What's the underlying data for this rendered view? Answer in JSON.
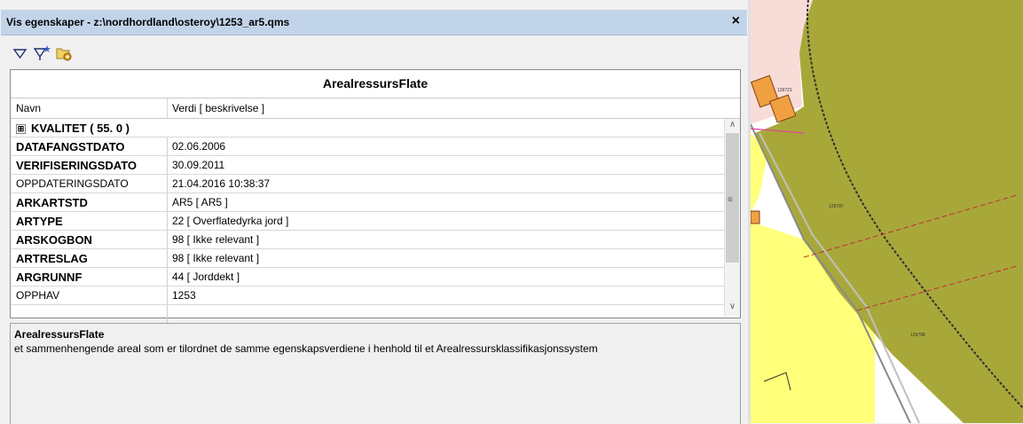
{
  "window": {
    "title": "Vis egenskaper - z:\\nordhordland\\osteroy\\1253_ar5.qms",
    "close_glyph": "×"
  },
  "toolbar": {
    "icons": [
      "filter-icon",
      "filter-star-icon",
      "settings-folder-icon"
    ]
  },
  "grid": {
    "header": "ArealressursFlate",
    "columns": [
      "Navn",
      "Verdi [ beskrivelse ]"
    ],
    "group_row": {
      "label": "KVALITET ( 55. 0 )",
      "expander": "⊞"
    },
    "rows": [
      {
        "name": "DATAFANGSTDATO",
        "value": "02.06.2006",
        "bold": true
      },
      {
        "name": "VERIFISERINGSDATO",
        "value": "30.09.2011",
        "bold": true
      },
      {
        "name": "OPPDATERINGSDATO",
        "value": "21.04.2016 10:38:37",
        "bold": false
      },
      {
        "name": "ARKARTSTD",
        "value": "AR5 [ AR5 ]",
        "bold": true
      },
      {
        "name": "ARTYPE",
        "value": "22 [ Overflatedyrka jord ]",
        "bold": true
      },
      {
        "name": "ARSKOGBON",
        "value": "98 [ Ikke relevant ]",
        "bold": true
      },
      {
        "name": "ARTRESLAG",
        "value": "98 [ Ikke relevant ]",
        "bold": true
      },
      {
        "name": "ARGRUNNF",
        "value": "44 [ Jorddekt ]",
        "bold": true
      },
      {
        "name": "OPPHAV",
        "value": "1253",
        "bold": false
      },
      {
        "name": "",
        "value": "",
        "bold": false
      }
    ]
  },
  "description": {
    "title": "ArealressursFlate",
    "text": "et sammenhengende areal som er tilordnet de samme egenskapsverdiene i henhold til et Arealressursklassifikasjonssystem"
  },
  "map": {
    "colors": {
      "farmland": "#a8a83a",
      "road": "#ffffff",
      "yellow": "#ffff7a",
      "pink": "#f8dcd8",
      "building": "#f0a040"
    },
    "labels": [
      "129721",
      "129797",
      "129798"
    ]
  }
}
